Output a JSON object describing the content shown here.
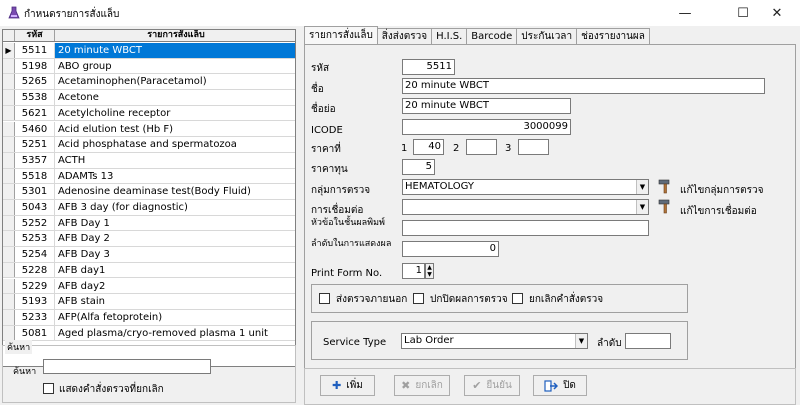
{
  "window": {
    "title": "กำหนดรายการสั่งแล็บ",
    "minimize": "—",
    "maximize": "☐",
    "close": "✕"
  },
  "grid": {
    "columns": [
      "รหัส",
      "รายการสั่งแล็บ"
    ],
    "current_row_marker": "▶",
    "rows": [
      {
        "code": "5511",
        "name": "20 minute WBCT"
      },
      {
        "code": "5198",
        "name": "ABO group"
      },
      {
        "code": "5265",
        "name": "Acetaminophen(Paracetamol)"
      },
      {
        "code": "5538",
        "name": "Acetone"
      },
      {
        "code": "5621",
        "name": "Acetylcholine receptor"
      },
      {
        "code": "5460",
        "name": "Acid elution test (Hb F)"
      },
      {
        "code": "5251",
        "name": "Acid phosphatase and spermatozoa"
      },
      {
        "code": "5357",
        "name": "ACTH"
      },
      {
        "code": "5518",
        "name": "ADAMTs 13"
      },
      {
        "code": "5301",
        "name": "Adenosine deaminase test(Body Fluid)"
      },
      {
        "code": "5043",
        "name": "AFB 3 day (for diagnostic)"
      },
      {
        "code": "5252",
        "name": "AFB Day 1"
      },
      {
        "code": "5253",
        "name": "AFB Day 2"
      },
      {
        "code": "5254",
        "name": "AFB Day 3"
      },
      {
        "code": "5228",
        "name": "AFB day1"
      },
      {
        "code": "5229",
        "name": "AFB day2"
      },
      {
        "code": "5193",
        "name": "AFB stain"
      },
      {
        "code": "5233",
        "name": "AFP(Alfa fetoprotein)"
      },
      {
        "code": "5081",
        "name": "Aged plasma/cryo-removed plasma 1 unit"
      }
    ]
  },
  "search": {
    "group_label": "ค้นหา",
    "label": "ค้นหา",
    "value": "",
    "show_cancelled_label": "แสดงคำสั่งตรวจที่ยกเลิก"
  },
  "tabs": [
    "รายการสั่งแล็บ",
    "สิ่งส่งตรวจ",
    "H.I.S.",
    "Barcode",
    "ประกันเวลา",
    "ช่องรายงานผล"
  ],
  "form": {
    "code_label": "รหัส",
    "code_value": "5511",
    "name_label": "ชื่อ",
    "name_value": "20 minute WBCT",
    "short_label": "ชื่อย่อ",
    "short_value": "20 minute WBCT",
    "icode_label": "ICODE",
    "icode_value": "3000099",
    "price_label": "ราคาที่",
    "price_1_label": "1",
    "price_1_value": "40",
    "price_2_label": "2",
    "price_2_value": "",
    "price_3_label": "3",
    "price_3_value": "",
    "cost_label": "ราคาทุน",
    "cost_value": "5",
    "group_label": "กลุ่มการตรวจ",
    "group_value": "HEMATOLOGY",
    "edit_group_label": "แก้ไขกลุ่มการตรวจ",
    "link_label": "การเชื่อมต่อ",
    "link_value": "",
    "edit_link_label": "แก้ไขการเชื่อมต่อ",
    "print_topic_label": "หัวข้อในชั้นผลพิมพ์",
    "print_topic_value": "",
    "order_label": "ลำดับในการแสดงผล",
    "order_value": "0",
    "print_form_label": "Print Form No.",
    "print_form_value": "1",
    "send_outside_label": "ส่งตรวจภายนอก",
    "hide_result_label": "ปกปิดผลการตรวจ",
    "cancel_order_label": "ยกเลิกคำสั่งตรวจ",
    "service_type_label": "Service Type",
    "service_type_value": "Lab Order",
    "seq_label": "ลำดับ",
    "seq_value": ""
  },
  "buttons": {
    "add": "เพิ่ม",
    "cancel": "ยกเลิก",
    "confirm": "ยืนยัน",
    "close": "ปิด"
  },
  "colors": {
    "selection": "#0078d7",
    "add_icon": "#1f5fbf",
    "close_icon": "#1f5fbf"
  }
}
